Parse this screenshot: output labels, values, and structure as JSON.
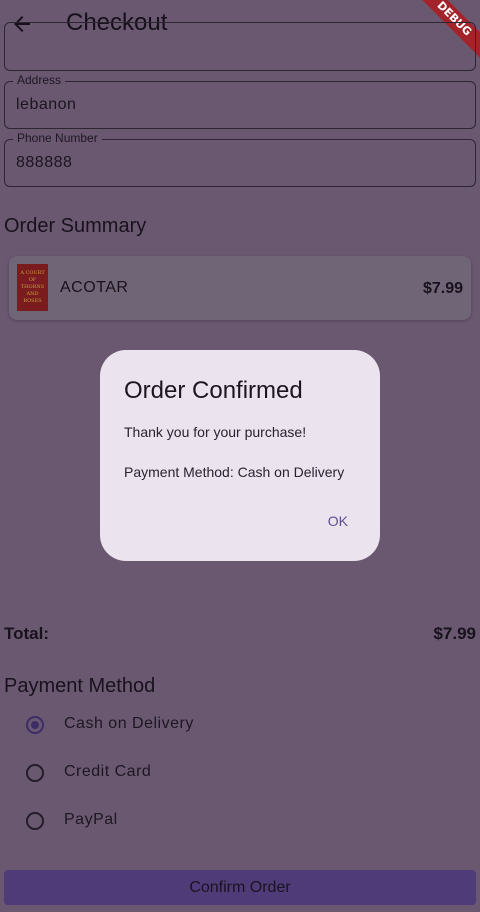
{
  "appbar": {
    "title": "Checkout",
    "back_icon": "arrow-left-icon",
    "debug_banner": "DEBUG"
  },
  "form": {
    "address": {
      "label": "Address",
      "value": "lebanon"
    },
    "phone": {
      "label": "Phone Number",
      "value": "888888"
    }
  },
  "order_summary": {
    "title": "Order Summary",
    "items": [
      {
        "name": "ACOTAR",
        "price": "$7.99",
        "cover_text": "A COURT OF THORNS AND ROSES"
      }
    ]
  },
  "total": {
    "label": "Total:",
    "value": "$7.99"
  },
  "payment": {
    "title": "Payment Method",
    "options": [
      {
        "label": "Cash on Delivery",
        "selected": true
      },
      {
        "label": "Credit Card",
        "selected": false
      },
      {
        "label": "PayPal",
        "selected": false
      }
    ]
  },
  "confirm_button": "Confirm Order",
  "dialog": {
    "title": "Order Confirmed",
    "message": "Thank you for your purchase!",
    "payment_line": "Payment Method: Cash on Delivery",
    "ok_label": "OK"
  },
  "colors": {
    "background": "#6a5871",
    "dialog_bg": "#ebe3ee",
    "accent": "#5d4d92",
    "button": "#4f3b77",
    "debug": "#a2242a"
  }
}
